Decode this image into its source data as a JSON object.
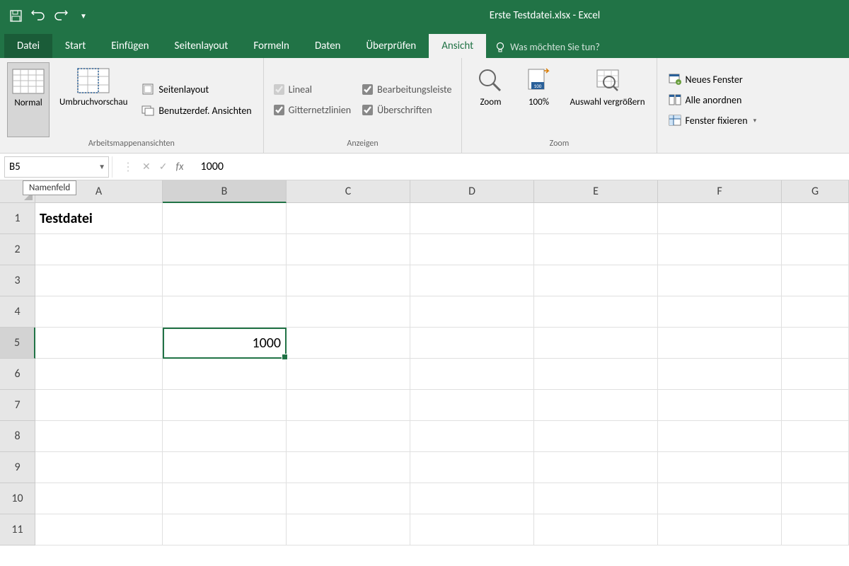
{
  "app_title": "Erste Testdatei.xlsx - Excel",
  "tabs": {
    "file": "Datei",
    "list": [
      "Start",
      "Einfügen",
      "Seitenlayout",
      "Formeln",
      "Daten",
      "Überprüfen",
      "Ansicht"
    ],
    "active": "Ansicht",
    "tell_me": "Was möchten Sie tun?"
  },
  "ribbon": {
    "views_group": {
      "label": "Arbeitsmappenansichten",
      "normal": "Normal",
      "page_break": "Umbruchvorschau",
      "page_layout": "Seitenlayout",
      "custom_views": "Benutzerdef. Ansichten"
    },
    "show_group": {
      "label": "Anzeigen",
      "ruler": "Lineal",
      "gridlines": "Gitternetzlinien",
      "formula_bar": "Bearbeitungsleiste",
      "headings": "Überschriften"
    },
    "zoom_group": {
      "label": "Zoom",
      "zoom": "Zoom",
      "hundred": "100%",
      "selection": "Auswahl vergrößern"
    },
    "window_group": {
      "new_window": "Neues Fenster",
      "arrange_all": "Alle anordnen",
      "freeze_panes": "Fenster fixieren"
    }
  },
  "name_box": {
    "value": "B5",
    "tooltip": "Namenfeld"
  },
  "formula_bar_value": "1000",
  "columns": [
    "A",
    "B",
    "C",
    "D",
    "E",
    "F",
    "G"
  ],
  "rows": [
    "1",
    "2",
    "3",
    "4",
    "5",
    "6",
    "7",
    "8",
    "9",
    "10",
    "11"
  ],
  "selected": {
    "col": "B",
    "row": "5"
  },
  "cells": {
    "A1": "Testdatei",
    "B5": "1000"
  }
}
